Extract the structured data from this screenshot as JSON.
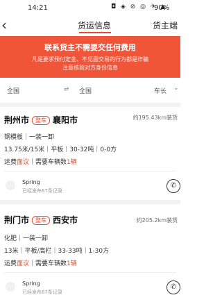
{
  "status_bar": {
    "time": "14:21",
    "icons": "◘ ◈ ⊘ ◎ ✈ ▲",
    "battery": "90%"
  },
  "nav": {
    "back_icon": "chevron-left-icon",
    "tab_cargo": "货运信息",
    "tab_truck": "货主端"
  },
  "warning": {
    "title": "联系货主不需要交任何费用",
    "line1": "凡是要求预付定金、不见面交易的行为都是诈骗",
    "line2": "注意核验对方身份信息"
  },
  "filter": {
    "from": "全国",
    "arrow": "⇌",
    "to": "全国",
    "length_label": "车长",
    "chevron": "⌄"
  },
  "listings": [
    {
      "from": "荆州市",
      "tag": "整车",
      "to": "襄阳市",
      "distance": "约195.43km装货",
      "goods": "钢模板｜一装一卸",
      "spec": "13.75米/15米｜平板｜30-32吨｜0-0方",
      "fee_prefix": "运费",
      "fee_red": "面议",
      "fee_mid": "｜需要车辆数",
      "fee_count": "1辆",
      "user": "Spring",
      "user_sub": "已经发布67条记录"
    },
    {
      "from": "荆门市",
      "tag": "整车",
      "to": "西安市",
      "distance": "约205.2km装货",
      "goods": "化肥｜一装一卸",
      "spec": "13米｜平板/高栏｜33-33吨｜1-30方",
      "fee_prefix": "运费",
      "fee_red": "面议",
      "fee_mid": "｜需要车辆数",
      "fee_count": "1辆",
      "user": "Spring",
      "user_sub": "已经发布67条记录"
    }
  ]
}
